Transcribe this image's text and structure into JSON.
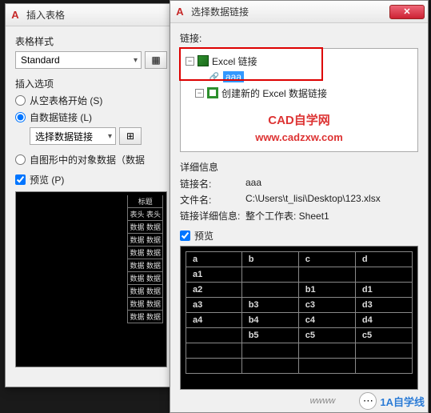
{
  "left_dialog": {
    "title": "插入表格",
    "style_label": "表格样式",
    "style_value": "Standard",
    "insert_label": "插入选项",
    "opt_empty": "从空表格开始 (S)",
    "opt_link": "自数据链接 (L)",
    "link_combo": "选择数据链接",
    "opt_obj": "自图形中的对象数据（数据",
    "preview_label": "预览 (P)",
    "mini_header": "标题",
    "mini_cells": [
      "表头 表头",
      "数据 数据",
      "数据 数据",
      "数据 数据",
      "数据 数据",
      "数据 数据",
      "数据 数据",
      "数据 数据",
      "数据 数据"
    ]
  },
  "right_dialog": {
    "title": "选择数据链接",
    "links_label": "链接:",
    "tree": {
      "root": "Excel 链接",
      "item_selected": "aaa",
      "item_new": "创建新的 Excel 数据链接"
    },
    "watermark_title": "CAD自学网",
    "watermark_url": "www.cadzxw.com",
    "details_label": "详细信息",
    "detail_name_k": "链接名:",
    "detail_name_v": "aaa",
    "detail_file_k": "文件名:",
    "detail_file_v": "C:\\Users\\t_lisi\\Desktop\\123.xlsx",
    "detail_info_k": "链接详细信息:",
    "detail_info_v": "整个工作表: Sheet1",
    "preview_label": "预览"
  },
  "chart_data": {
    "type": "table",
    "columns": [
      "a",
      "b",
      "c",
      "d"
    ],
    "rows": [
      {
        "a": "a1",
        "b": "",
        "c": "",
        "d": ""
      },
      {
        "a": "a2",
        "b": "",
        "c": "b1",
        "d": "d1"
      },
      {
        "a": "a3",
        "b": "b3",
        "c": "c3",
        "d": "d3"
      },
      {
        "a": "a4",
        "b": "b4",
        "c": "c4",
        "d": "d4"
      },
      {
        "a": "",
        "b": "b5",
        "c": "c5",
        "d": "c5"
      },
      {
        "a": "",
        "b": "",
        "c": "",
        "d": ""
      },
      {
        "a": "",
        "b": "",
        "c": "",
        "d": ""
      }
    ]
  },
  "footer": {
    "wwww": "wwww",
    "brand": "1A自学线"
  }
}
